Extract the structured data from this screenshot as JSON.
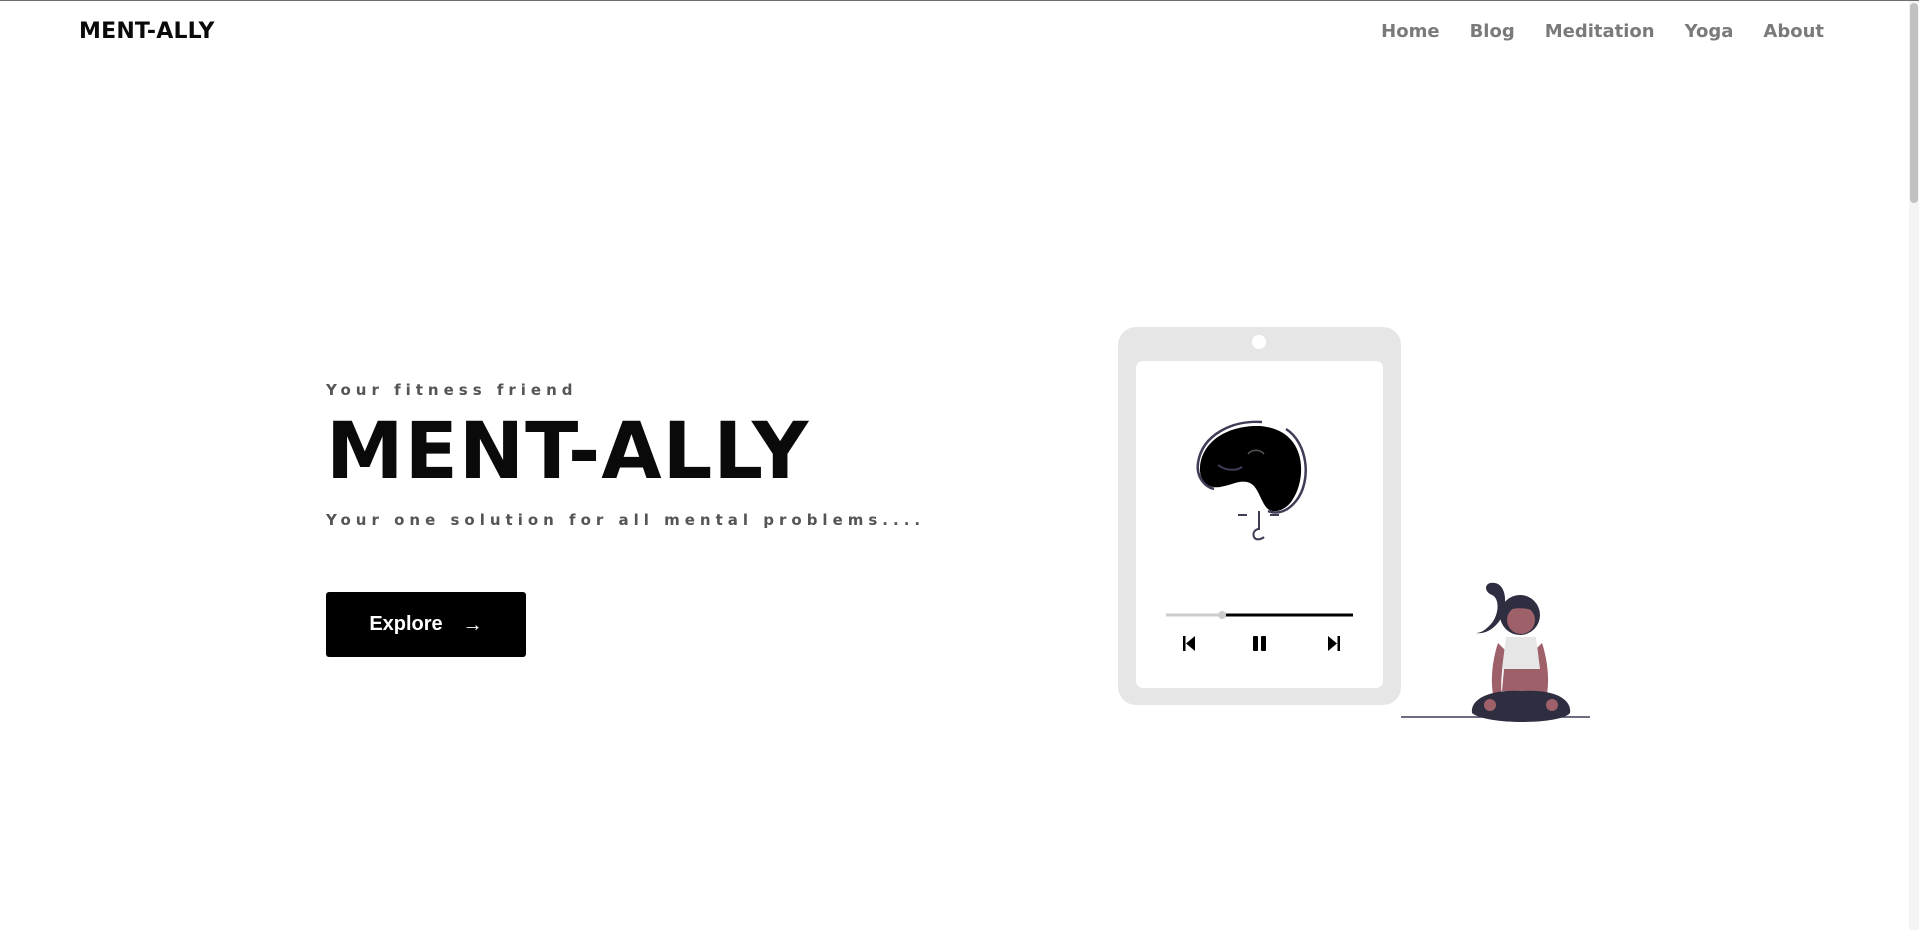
{
  "header": {
    "brand": "MENT-ALLY",
    "nav": [
      {
        "label": "Home"
      },
      {
        "label": "Blog"
      },
      {
        "label": "Meditation"
      },
      {
        "label": "Yoga"
      },
      {
        "label": "About"
      }
    ]
  },
  "hero": {
    "eyebrow": "Your fitness friend",
    "title": "MENT-ALLY",
    "subtitle": "Your one solution for all mental problems....",
    "cta_label": "Explore",
    "cta_icon": "arrow-right-icon"
  },
  "player": {
    "progress": 0.3
  },
  "colors": {
    "nav_text": "#7a7a7a",
    "cta_bg": "#000000",
    "tablet_frame": "#e6e6e6",
    "figure_skin": "#9e616a",
    "figure_dark": "#2f2e41"
  }
}
